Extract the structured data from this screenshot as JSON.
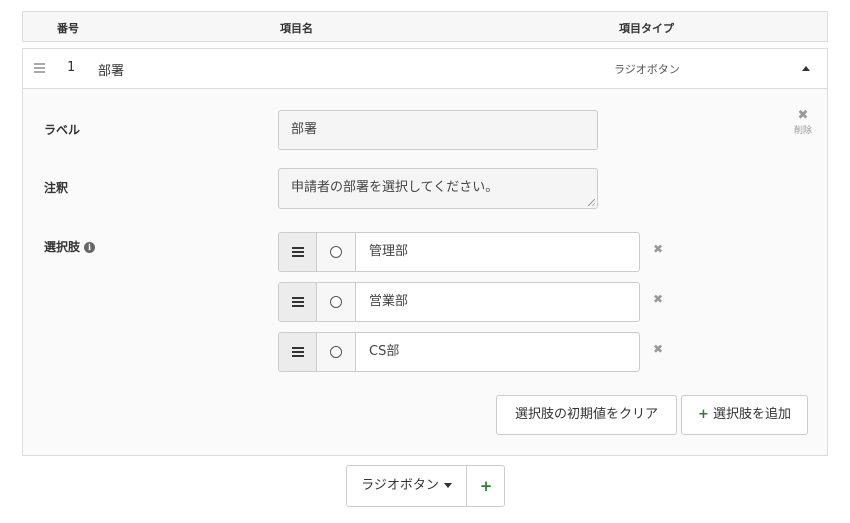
{
  "table_header": {
    "number": "番号",
    "item_name": "項目名",
    "item_type": "項目タイプ"
  },
  "item": {
    "number": "1",
    "name": "部署",
    "type": "ラジオボタン",
    "delete_label": "削除",
    "delete_icon": "close-icon",
    "label_field": {
      "label": "ラベル",
      "value": "部署"
    },
    "note_field": {
      "label": "注釈",
      "value": "申請者の部署を選択してください。"
    },
    "choices_field": {
      "label": "選択肢",
      "info_icon": "i",
      "options": [
        "管理部",
        "営業部",
        "CS部"
      ]
    },
    "clear_default_button": "選択肢の初期値をクリア",
    "add_choice_button": "選択肢を追加",
    "add_icon": "+"
  },
  "bottom": {
    "type_select": "ラジオボタン",
    "add_icon": "+"
  },
  "colors": {
    "border": "#dddddd",
    "panel_bg": "#fafafa",
    "plus_green": "#2e7d32",
    "muted": "#999999"
  }
}
